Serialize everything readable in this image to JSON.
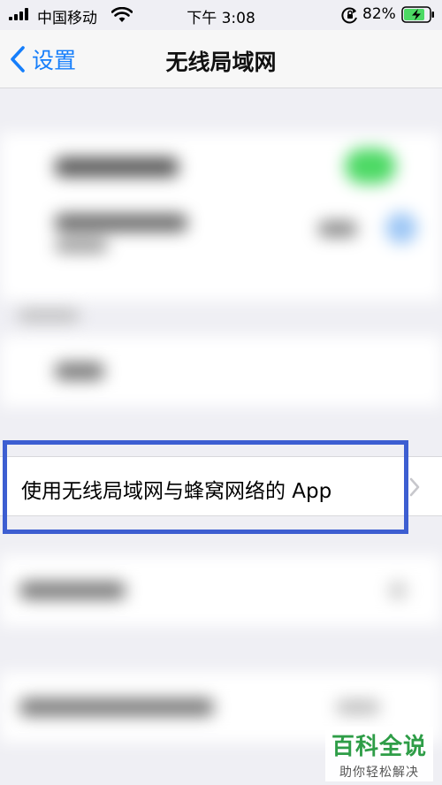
{
  "status_bar": {
    "carrier": "中国移动",
    "time": "下午 3:08",
    "battery_percent": "82%",
    "battery_level": 0.82,
    "battery_color": "#4cd964"
  },
  "nav": {
    "back_label": "设置",
    "title": "无线局域网"
  },
  "highlighted_row": {
    "label": "使用无线局域网与蜂窝网络的 App"
  },
  "colors": {
    "accent": "#157efb",
    "highlight": "#3d5ed1",
    "toggle_on": "#4cd964"
  },
  "watermark": {
    "title": "百科全说",
    "subtitle": "助你轻松解决"
  }
}
